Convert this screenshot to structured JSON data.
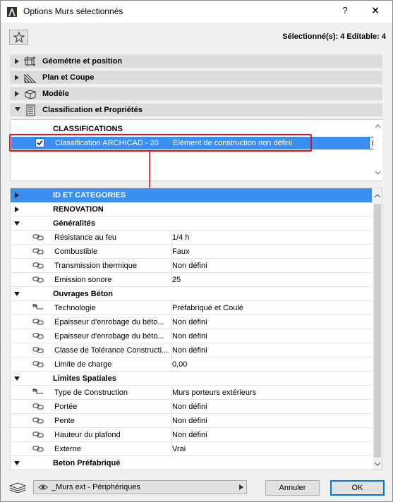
{
  "window": {
    "title": "Options Murs sélectionnés",
    "help": "?",
    "close": "✕"
  },
  "selection_info": "Sélectionné(s): 4 Editable: 4",
  "sections": [
    {
      "label": "Géométrie et position",
      "icon": "geometry-icon",
      "expanded": false
    },
    {
      "label": "Plan et Coupe",
      "icon": "floorplan-icon",
      "expanded": false
    },
    {
      "label": "Modèle",
      "icon": "model-icon",
      "expanded": false
    },
    {
      "label": "Classification et Propriétés",
      "icon": "document-icon",
      "expanded": true
    }
  ],
  "classifications": {
    "header": "CLASSIFICATIONS",
    "row": {
      "checked": true,
      "system": "Classification ARCHICAD - 20",
      "value": "Elément de construction non défini"
    }
  },
  "properties": {
    "groups": {
      "id": "ID ET CATEGORIES",
      "renovation": "RENOVATION",
      "generalites": "Généralités",
      "ouvrages": "Ouvrages Béton",
      "limites": "Limites Spatiales",
      "prefab": "Beton Préfabriqué"
    },
    "generalites": [
      {
        "name": "Résistance au feu",
        "value": "1/4 h"
      },
      {
        "name": "Combustible",
        "value": "Faux"
      },
      {
        "name": "Transmission thermique",
        "value": "Non défini"
      },
      {
        "name": "Emission sonore",
        "value": "25"
      }
    ],
    "ouvrages": [
      {
        "name": "Technologie",
        "value": "Préfabriqué et Coulé"
      },
      {
        "name": "Epaisseur d'enrobage du béto...",
        "value": "Non défini"
      },
      {
        "name": "Epaisseur d'enrobage du béto...",
        "value": "Non défini"
      },
      {
        "name": "Classe de Tolérance Constructi...",
        "value": "Non défini"
      },
      {
        "name": "Limite de charge",
        "value": "0,00"
      }
    ],
    "limites": [
      {
        "name": "Type de Construction",
        "value": "Murs porteurs extérieurs"
      },
      {
        "name": "Portée",
        "value": "Non défini"
      },
      {
        "name": "Pente",
        "value": "Non défini"
      },
      {
        "name": "Hauteur du plafond",
        "value": "Non défini"
      },
      {
        "name": "Externe",
        "value": "Vrai"
      }
    ]
  },
  "footer": {
    "layer": "_Murs ext - Périphériques",
    "cancel": "Annuler",
    "ok": "OK"
  },
  "colors": {
    "selection": "#3b8ff0",
    "highlight_box": "#e0141c",
    "arrow": "#e0141c"
  }
}
